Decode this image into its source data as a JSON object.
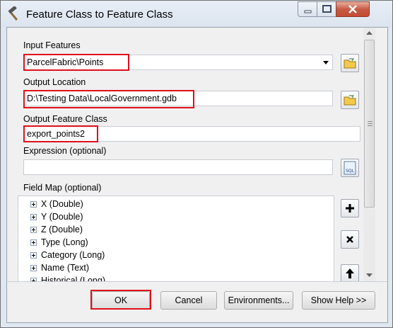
{
  "window": {
    "title": "Feature Class to Feature Class"
  },
  "form": {
    "input_features": {
      "label": "Input Features",
      "value": "ParcelFabric\\Points"
    },
    "output_location": {
      "label": "Output Location",
      "value": "D:\\Testing Data\\LocalGovernment.gdb"
    },
    "output_feature_class": {
      "label": "Output Feature Class",
      "value": "export_points2"
    },
    "expression": {
      "label": "Expression (optional)",
      "value": "",
      "sql_label": "SQL"
    },
    "field_map": {
      "label": "Field Map (optional)",
      "items": [
        {
          "label": "X (Double)"
        },
        {
          "label": "Y (Double)"
        },
        {
          "label": "Z (Double)"
        },
        {
          "label": "Type (Long)"
        },
        {
          "label": "Category (Long)"
        },
        {
          "label": "Name (Text)"
        },
        {
          "label": "Historical (Long)"
        }
      ]
    }
  },
  "buttons": {
    "ok": "OK",
    "cancel": "Cancel",
    "environments": "Environments...",
    "show_help": "Show Help >>"
  },
  "colors": {
    "highlight": "#e0101a",
    "title_bar": "#dbe4ef",
    "close_button": "#c85a44"
  }
}
